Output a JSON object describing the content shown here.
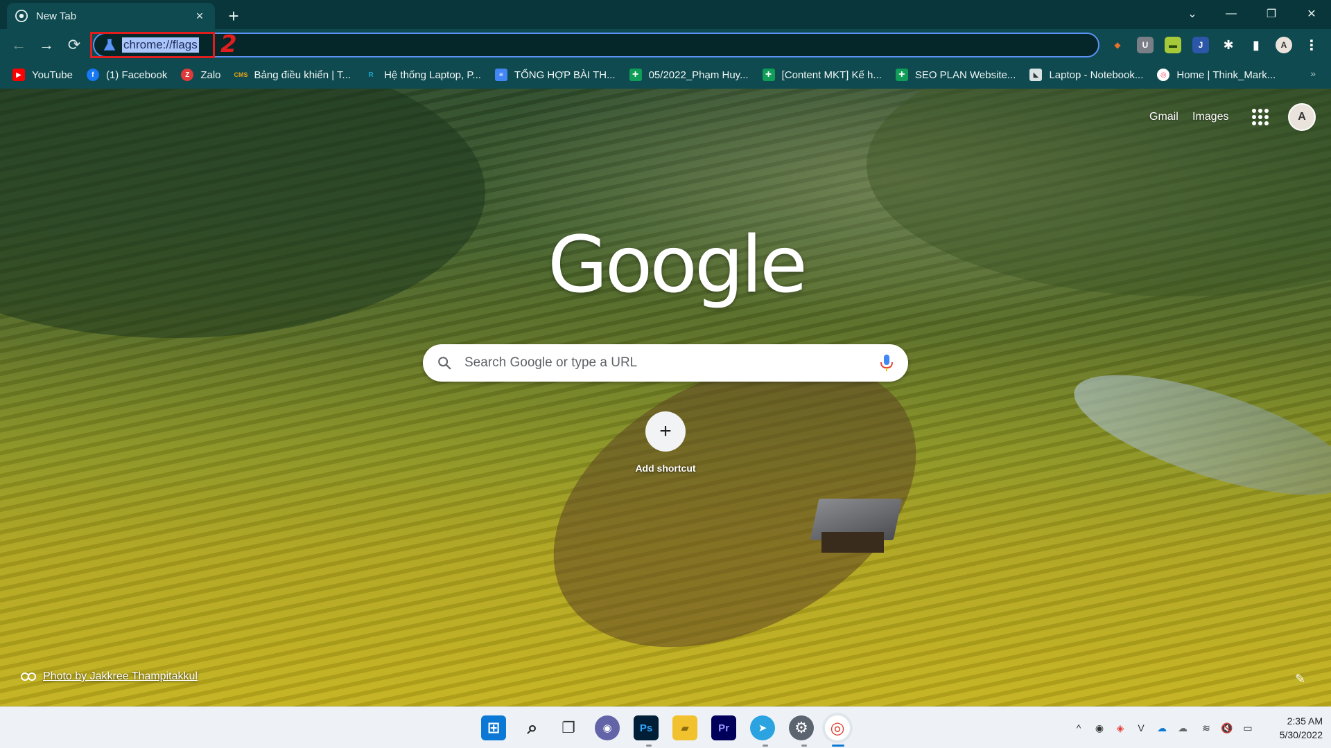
{
  "tab": {
    "title": "New Tab",
    "close": "×"
  },
  "new_tab": "+",
  "window_controls": {
    "dropdown": "⌄",
    "minimize": "—",
    "restore": "❐",
    "close": "✕"
  },
  "nav": {
    "back": "←",
    "forward": "→",
    "reload": "⟳"
  },
  "omnibox": {
    "url": "chrome://flags"
  },
  "annotation": {
    "step_number": "2"
  },
  "extensions": [
    {
      "name": "honey",
      "glyph": "◆",
      "color": "#e8712b"
    },
    {
      "name": "ublock",
      "glyph": "U",
      "color": "#7a7f87"
    },
    {
      "name": "ext-green",
      "glyph": "▬",
      "color": "#a6c93a"
    },
    {
      "name": "ext-j",
      "glyph": "J",
      "color": "#2c56a8"
    },
    {
      "name": "puzzle",
      "glyph": "✱",
      "color": "transparent"
    },
    {
      "name": "sidepanel",
      "glyph": "▮",
      "color": "transparent"
    }
  ],
  "profile_initial": "A",
  "menu": "⋮",
  "bookmarks": [
    {
      "label": "YouTube",
      "icon": "youtube-icon",
      "color": "#ff0000",
      "glyph": "▶"
    },
    {
      "label": "(1) Facebook",
      "icon": "facebook-icon",
      "color": "#1877f2",
      "glyph": "f"
    },
    {
      "label": "Zalo",
      "icon": "zalo-icon",
      "color": "#e03a3a",
      "glyph": "Z"
    },
    {
      "label": "Bảng điều khiển | T...",
      "icon": "cms-icon",
      "color": "#e8a317",
      "glyph": "CMS"
    },
    {
      "label": "Hệ thống Laptop, P...",
      "icon": "rio-icon",
      "color": "#1aa2c9",
      "glyph": "R"
    },
    {
      "label": "TỔNG HỢP BÀI TH...",
      "icon": "docs-icon",
      "color": "#4285f4",
      "glyph": "≡"
    },
    {
      "label": "05/2022_Phạm Huy...",
      "icon": "sheets-icon",
      "color": "#0f9d58",
      "glyph": "+"
    },
    {
      "label": "[Content MKT] Kế h...",
      "icon": "sheets-icon",
      "color": "#0f9d58",
      "glyph": "+"
    },
    {
      "label": "SEO PLAN Website...",
      "icon": "sheets-icon",
      "color": "#0f9d58",
      "glyph": "+"
    },
    {
      "label": "Laptop - Notebook...",
      "icon": "laptop-icon",
      "color": "#d9e3e3",
      "glyph": "◣"
    },
    {
      "label": "Home | Think_Mark...",
      "icon": "thinkmark-icon",
      "color": "#ff4a6e",
      "glyph": "◎"
    }
  ],
  "bookmarks_more": "»",
  "ntp": {
    "gmail": "Gmail",
    "images": "Images",
    "avatar_initial": "A",
    "logo": "Google",
    "search_placeholder": "Search Google or type a URL",
    "add_shortcut_label": "Add shortcut",
    "add_shortcut_glyph": "+",
    "photo_credit": "Photo by Jakkree Thampitakkul",
    "customize_glyph": "✎"
  },
  "taskbar": {
    "apps": [
      {
        "name": "windows-start",
        "glyph": "⊞",
        "color": "#0a78d4"
      },
      {
        "name": "search",
        "glyph": "⌕",
        "color": "transparent"
      },
      {
        "name": "task-view",
        "glyph": "❐",
        "color": "transparent"
      },
      {
        "name": "teams-chat",
        "glyph": "◉",
        "color": "#6264a7"
      },
      {
        "name": "photoshop",
        "glyph": "Ps",
        "color": "#001e36"
      },
      {
        "name": "file-explorer",
        "glyph": "▰",
        "color": "#f2c12e"
      },
      {
        "name": "premiere",
        "glyph": "Pr",
        "color": "#00005b"
      },
      {
        "name": "telegram",
        "glyph": "➤",
        "color": "#2aa3e0"
      },
      {
        "name": "settings",
        "glyph": "⚙",
        "color": "#5c6470"
      },
      {
        "name": "chrome",
        "glyph": "◎",
        "color": "#ffffff"
      }
    ],
    "tray": [
      "^",
      "◉",
      "◈",
      "V",
      "☁",
      "☁",
      "≋",
      "🔇",
      "▭"
    ],
    "time": "2:35 AM",
    "date": "5/30/2022"
  }
}
